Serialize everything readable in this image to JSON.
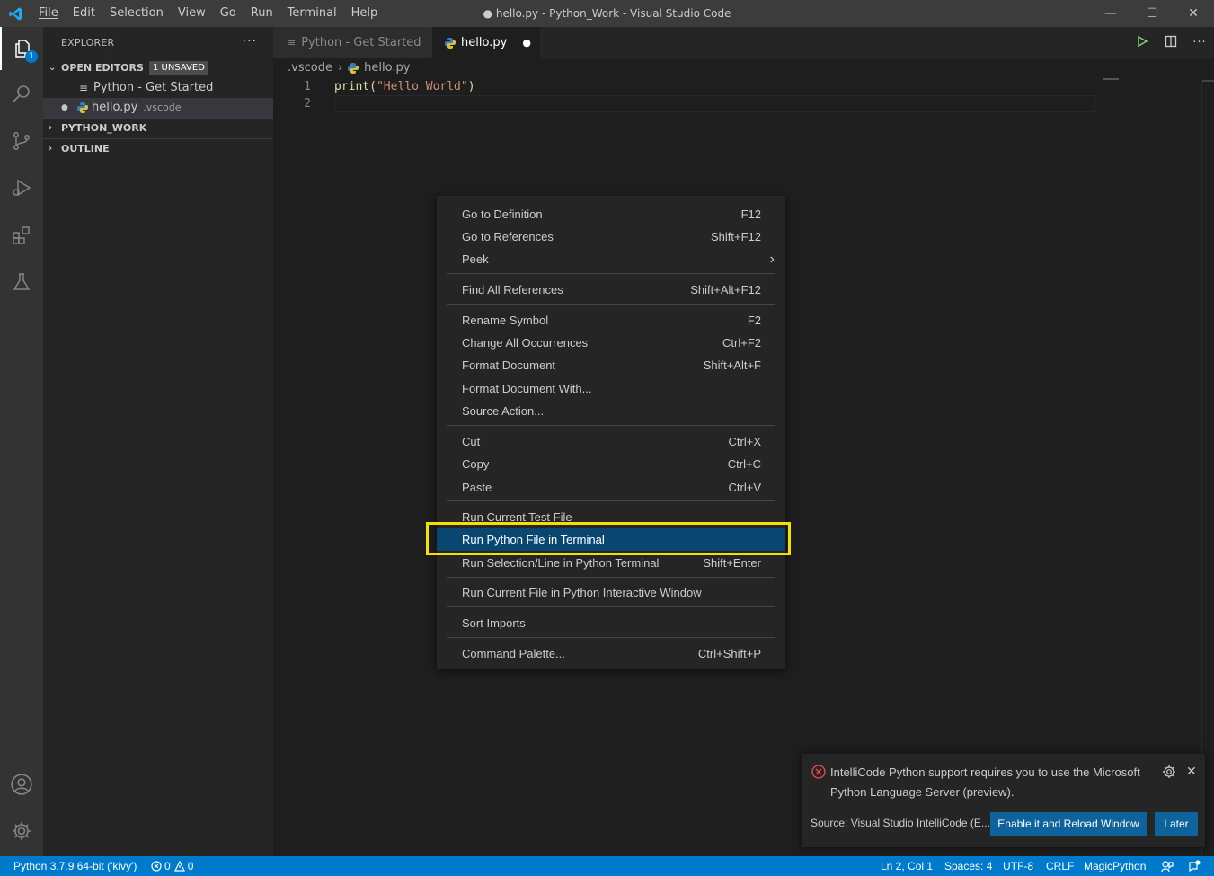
{
  "window": {
    "title": "● hello.py - Python_Work - Visual Studio Code",
    "menu": [
      "File",
      "Edit",
      "Selection",
      "View",
      "Go",
      "Run",
      "Terminal",
      "Help"
    ],
    "minimize": "—",
    "maximize": "☐",
    "close": "✕"
  },
  "activity_bar": {
    "explorer_badge": "1",
    "icons": [
      "files-icon",
      "search-icon",
      "source-control-icon",
      "run-debug-icon",
      "extensions-icon",
      "testing-icon",
      "account-icon",
      "manage-gear-icon"
    ]
  },
  "sidebar": {
    "title": "EXPLORER",
    "more": "···",
    "open_editors": {
      "label": "OPEN EDITORS",
      "badge": "1 UNSAVED",
      "items": [
        {
          "icon": "≡",
          "name": "Python - Get Started",
          "desc": ""
        },
        {
          "icon": "●",
          "name": "hello.py",
          "desc": ".vscode"
        }
      ]
    },
    "workspace_label": "PYTHON_WORK",
    "outline_label": "OUTLINE"
  },
  "tabs": [
    {
      "label": "Python - Get Started",
      "active": false
    },
    {
      "label": "hello.py",
      "active": true,
      "dirty_dot": "●"
    }
  ],
  "breadcrumb": {
    "folder": ".vscode",
    "separator": "›",
    "file": "hello.py"
  },
  "editor": {
    "lines": [
      {
        "number": "1",
        "func": "print(",
        "string": "\"Hello World\"",
        "close": ")"
      },
      {
        "number": "2"
      }
    ]
  },
  "context_menu": {
    "items": [
      {
        "label": "Go to Definition",
        "key": "F12"
      },
      {
        "label": "Go to References",
        "key": "Shift+F12"
      },
      {
        "label": "Peek",
        "key": "›"
      },
      {
        "label": "Find All References",
        "key": "Shift+Alt+F12"
      },
      {
        "label": "Rename Symbol",
        "key": "F2"
      },
      {
        "label": "Change All Occurrences",
        "key": "Ctrl+F2"
      },
      {
        "label": "Format Document",
        "key": "Shift+Alt+F"
      },
      {
        "label": "Format Document With...",
        "key": ""
      },
      {
        "label": "Source Action...",
        "key": ""
      },
      {
        "label": "Cut",
        "key": "Ctrl+X"
      },
      {
        "label": "Copy",
        "key": "Ctrl+C"
      },
      {
        "label": "Paste",
        "key": "Ctrl+V"
      },
      {
        "label": "Run Current Test File",
        "key": ""
      },
      {
        "label": "Run Python File in Terminal",
        "key": ""
      },
      {
        "label": "Run Selection/Line in Python Terminal",
        "key": "Shift+Enter"
      },
      {
        "label": "Run Current File in Python Interactive Window",
        "key": ""
      },
      {
        "label": "Sort Imports",
        "key": ""
      },
      {
        "label": "Command Palette...",
        "key": "Ctrl+Shift+P"
      }
    ],
    "highlighted": "Run Python File in Terminal"
  },
  "notification": {
    "message": "IntelliCode Python support requires you to use the Microsoft Python Language Server (preview).",
    "source": "Source: Visual Studio IntelliCode (E...",
    "primary_button": "Enable it and Reload Window",
    "secondary_button": "Later",
    "close": "✕"
  },
  "status_bar": {
    "interpreter": "Python 3.7.9 64-bit ('kivy')",
    "errors": "0",
    "warnings": "0",
    "position": "Ln 2, Col 1",
    "spaces": "Spaces: 4",
    "encoding": "UTF-8",
    "eol": "CRLF",
    "language": "MagicPython"
  },
  "colors": {
    "accent": "#007acc",
    "highlight_box": "#f3e200",
    "string": "#ce9178",
    "function": "#dcdcaa",
    "menu_selection": "#094771",
    "error": "#f14c4c"
  }
}
